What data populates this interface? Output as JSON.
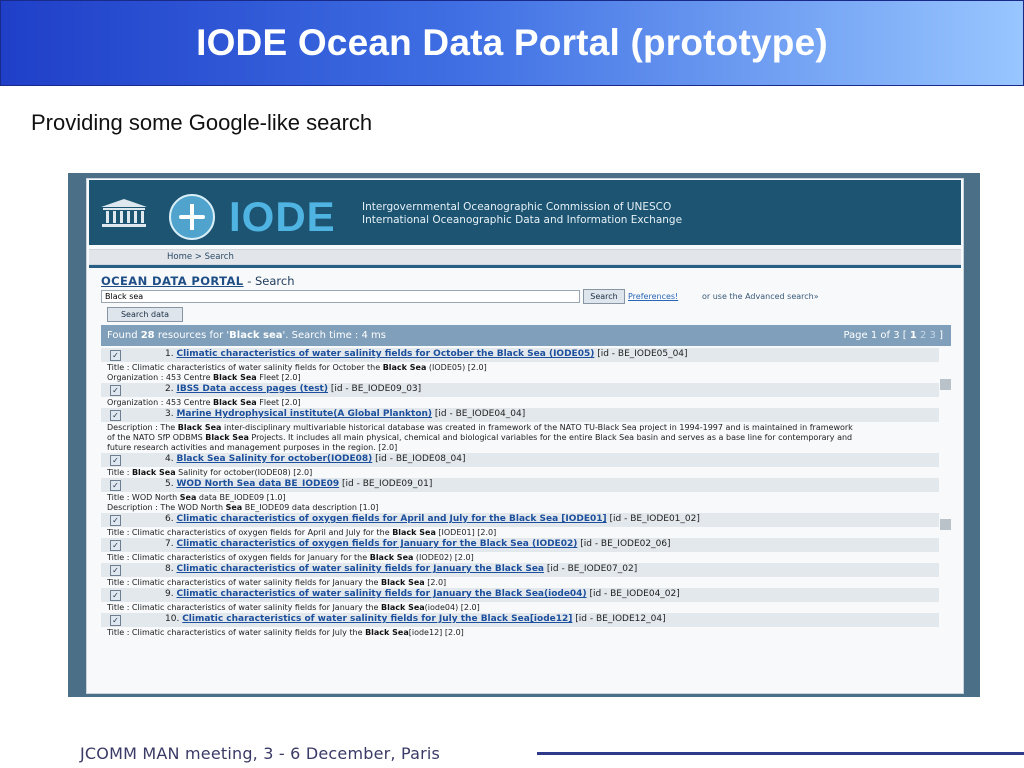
{
  "slide": {
    "title": "IODE Ocean Data Portal (prototype)",
    "subtitle": "Providing some Google-like search",
    "footer": "JCOMM MAN meeting, 3 - 6 December, Paris"
  },
  "portal": {
    "logo_text": "IODE",
    "header_line1": "Intergovernmental Oceanographic Commission of UNESCO",
    "header_line2": "International Oceanographic Data and Information Exchange",
    "breadcrumb": "Home >  Search",
    "portal_name": "OCEAN DATA PORTAL",
    "page_suffix": " - Search",
    "search_value": "Black sea",
    "search_button": "Search",
    "preferences_link": "Preferences!",
    "advanced_search": "or use the Advanced search»",
    "search_data_button": "Search data",
    "found_prefix": "Found ",
    "found_count": "28",
    "found_mid": " resources for '",
    "found_query": "Black sea",
    "found_suffix": "'. Search time : 4 ms",
    "paging": {
      "prefix": "Page 1 of 3 [ ",
      "current": "1",
      "rest": " 2 3",
      "suffix": " ]"
    },
    "results": [
      {
        "num": "1.",
        "title": "Climatic characteristics of water salinity fields for October the Black Sea (IODE05)",
        "id": "[id - BE_IODE05_04]",
        "checked": "✓",
        "meta": [
          {
            "a": "Title : Climatic characteristics of water salinity fields for October the ",
            "b": "Black Sea",
            "c": " (IODE05) [2.0]"
          },
          {
            "a": "Organization : 453 Centre ",
            "b": "Black Sea",
            "c": " Fleet [2.0]"
          }
        ]
      },
      {
        "num": "2.",
        "title": "IBSS Data access pages (test)",
        "id": "[id - BE_IODE09_03]",
        "checked": "✓",
        "meta": [
          {
            "a": "Organization : 453 Centre ",
            "b": "Black Sea",
            "c": " Fleet [2.0]"
          }
        ]
      },
      {
        "num": "3.",
        "title": "Marine Hydrophysical institute(A Global Plankton)",
        "id": "[id - BE_IODE04_04]",
        "checked": "✓",
        "meta": [
          {
            "a": "Description : The ",
            "b": "Black Sea",
            "c": " inter-disciplinary multivariable historical database was created in framework of the NATO TU-Black Sea project in 1994-1997 and is maintained in framework"
          },
          {
            "a": "of the NATO SfP ODBMS ",
            "b": "Black Sea",
            "c": " Projects. It includes all main physical, chemical and biological variables for the entire Black Sea basin and serves as a base line for contemporary and"
          },
          {
            "a": "future research activities and management purposes in the region. [2.0]",
            "b": "",
            "c": ""
          }
        ]
      },
      {
        "num": "4.",
        "title": "Black Sea Salinity for october(IODE08)",
        "id": "[id - BE_IODE08_04]",
        "checked": "✓",
        "meta": [
          {
            "a": "Title : ",
            "b": "Black Sea",
            "c": " Salinity for october(IODE08) [2.0]"
          }
        ]
      },
      {
        "num": "5.",
        "title": "WOD North Sea data BE_IODE09",
        "id": "[id - BE_IODE09_01]",
        "checked": "✓",
        "meta": [
          {
            "a": "Title : WOD North ",
            "b": "Sea",
            "c": " data BE_IODE09 [1.0]"
          },
          {
            "a": "Description : The WOD North ",
            "b": "Sea",
            "c": " BE_IODE09 data description [1.0]"
          }
        ]
      },
      {
        "num": "6.",
        "title": "Climatic characteristics of oxygen fields for April and July for the Black Sea [IODE01]",
        "id": "[id - BE_IODE01_02]",
        "checked": "✓",
        "meta": [
          {
            "a": "Title : Climatic characteristics of oxygen fields for April and July for the ",
            "b": "Black Sea",
            "c": " [IODE01] [2.0]"
          }
        ]
      },
      {
        "num": "7.",
        "title": "Climatic characteristics of oxygen fields for January for the Black Sea (IODE02)",
        "id": "[id - BE_IODE02_06]",
        "checked": "✓",
        "meta": [
          {
            "a": "Title : Climatic characteristics of oxygen fields for January for the ",
            "b": "Black Sea",
            "c": " (IODE02) [2.0]"
          }
        ]
      },
      {
        "num": "8.",
        "title": "Climatic characteristics of water salinity fields for January the Black Sea",
        "id": "[id - BE_IODE07_02]",
        "checked": "✓",
        "meta": [
          {
            "a": "Title : Climatic characteristics of water salinity fields for January the ",
            "b": "Black Sea",
            "c": " [2.0]"
          }
        ]
      },
      {
        "num": "9.",
        "title": "Climatic characteristics of water salinity fields for January the Black Sea(iode04)",
        "id": "[id - BE_IODE04_02]",
        "checked": "✓",
        "meta": [
          {
            "a": "Title : Climatic characteristics of water salinity fields for January the ",
            "b": "Black Sea",
            "c": "(iode04) [2.0]"
          }
        ]
      },
      {
        "num": "10.",
        "title": "Climatic characteristics of water salinity fields for July the Black Sea[iode12]",
        "id": "[id - BE_IODE12_04]",
        "checked": "✓",
        "meta": [
          {
            "a": "Title : Climatic characteristics of water salinity fields for July the ",
            "b": "Black Sea",
            "c": "[iode12] [2.0]"
          }
        ]
      }
    ]
  },
  "colors": {
    "banner_start": "#1f3fc8",
    "banner_end": "#98c6ff",
    "header_bg": "#1c5472",
    "link": "#1c4f9c",
    "found_bar": "#7f9fba",
    "footer_line": "#2e3b8c"
  },
  "icons": [
    "unesco-temple-logo",
    "ioc-circle-logo",
    "checkbox-icon",
    "scrollbar-thumb"
  ]
}
